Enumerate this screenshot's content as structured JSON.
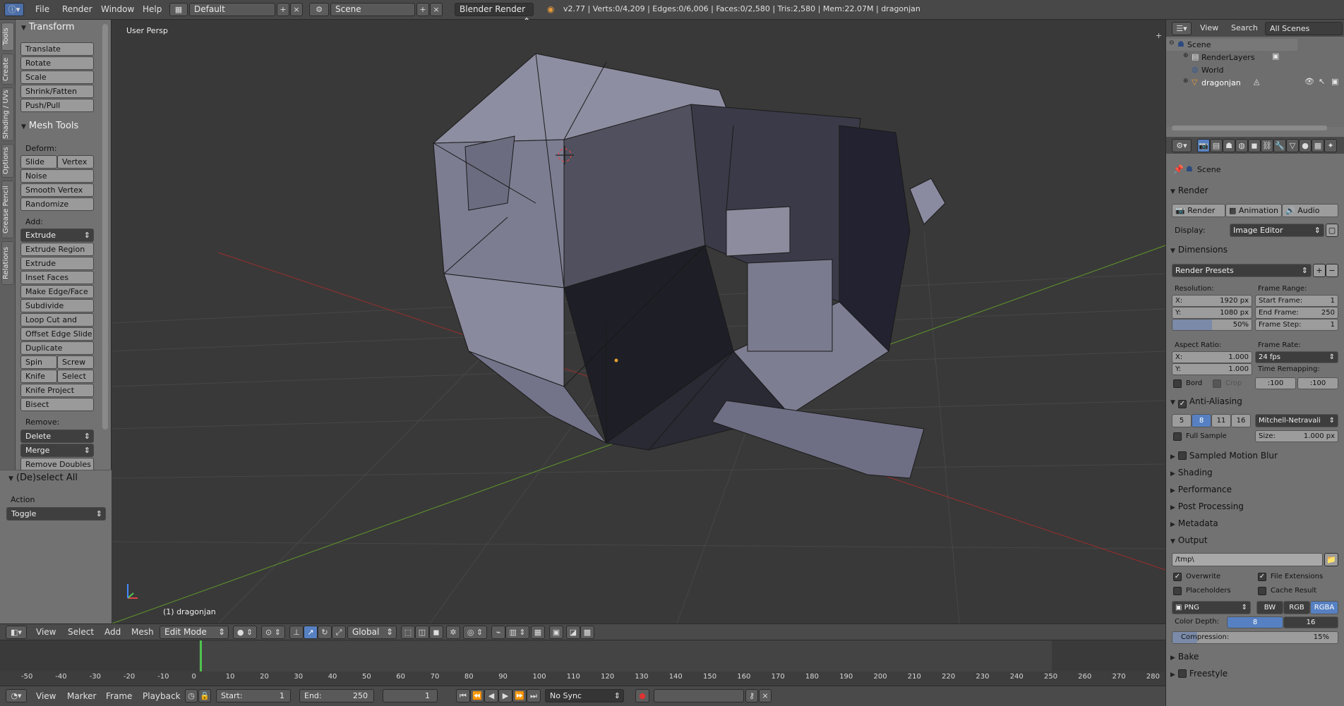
{
  "topbar": {
    "menu": [
      "File",
      "Render",
      "Window",
      "Help"
    ],
    "layout": "Default",
    "scene": "Scene",
    "engine": "Blender Render",
    "info": "v2.77 | Verts:0/4,209 | Edges:0/6,006 | Faces:0/2,580 | Tris:2,580 | Mem:22.07M | dragonjan"
  },
  "toolshelf": {
    "tabs": [
      "Tools",
      "Create",
      "Shading / UVs",
      "Options",
      "Grease Pencil",
      "Relations"
    ],
    "transform_title": "Transform",
    "transform": [
      "Translate",
      "Rotate",
      "Scale",
      "Shrink/Fatten",
      "Push/Pull"
    ],
    "mesh_title": "Mesh Tools",
    "deform_label": "Deform:",
    "slide_edge": "Slide Ed",
    "vertex": "Vertex",
    "deform": [
      "Noise",
      "Smooth Vertex",
      "Randomize"
    ],
    "add_label": "Add:",
    "extrude": "Extrude",
    "add": [
      "Extrude Region",
      "Extrude Individual",
      "Inset Faces",
      "Make Edge/Face",
      "Subdivide",
      "Loop Cut and Slide",
      "Offset Edge Slide",
      "Duplicate"
    ],
    "spin": "Spin",
    "screw": "Screw",
    "knife": "Knife",
    "select": "Select",
    "knife_project": "Knife Project",
    "bisect": "Bisect",
    "remove_label": "Remove:",
    "delete": "Delete",
    "merge": "Merge",
    "remove_doubles": "Remove Doubles",
    "op_title": "(De)select All",
    "action_label": "Action",
    "action_value": "Toggle"
  },
  "viewport": {
    "view_name": "User Persp",
    "object_label": "(1) dragonjan"
  },
  "header3d": {
    "menus": [
      "View",
      "Select",
      "Add",
      "Mesh"
    ],
    "mode": "Edit Mode",
    "orientation": "Global"
  },
  "timeline": {
    "ticks": [
      "-50",
      "-40",
      "-30",
      "-20",
      "-10",
      "0",
      "10",
      "20",
      "30",
      "40",
      "50",
      "60",
      "70",
      "80",
      "90",
      "100",
      "110",
      "120",
      "130",
      "140",
      "150",
      "160",
      "170",
      "180",
      "190",
      "200",
      "210",
      "220",
      "230",
      "240",
      "250",
      "260",
      "270",
      "280"
    ],
    "menus": [
      "View",
      "Marker",
      "Frame",
      "Playback"
    ],
    "start_label": "Start:",
    "start": "1",
    "end_label": "End:",
    "end": "250",
    "current": "1",
    "sync": "No Sync"
  },
  "outliner": {
    "view": "View",
    "search": "Search",
    "scope": "All Scenes",
    "items": [
      "Scene",
      "RenderLayers",
      "World",
      "dragonjan"
    ]
  },
  "properties": {
    "context": "Scene",
    "render_title": "Render",
    "render_btn": "Render",
    "animation_btn": "Animation",
    "audio_btn": "Audio",
    "display_label": "Display:",
    "display_value": "Image Editor",
    "dimensions_title": "Dimensions",
    "presets": "Render Presets",
    "resolution_label": "Resolution:",
    "res_x": "X:",
    "res_x_val": "1920 px",
    "res_y": "Y:",
    "res_y_val": "1080 px",
    "res_pct": "50%",
    "frame_range_label": "Frame Range:",
    "start_frame": "Start Frame:",
    "start_frame_val": "1",
    "end_frame": "End Frame:",
    "end_frame_val": "250",
    "frame_step": "Frame Step:",
    "frame_step_val": "1",
    "aspect_label": "Aspect Ratio:",
    "asp_x": "X:",
    "asp_x_val": "1.000",
    "asp_y": "Y:",
    "asp_y_val": "1.000",
    "frame_rate_label": "Frame Rate:",
    "frame_rate": "24 fps",
    "time_remap_label": "Time Remapping:",
    "remap_old": ":100",
    "remap_new": ":100",
    "bord": "Bord",
    "crop": "Crop",
    "aa_title": "Anti-Aliasing",
    "aa_samples": [
      "5",
      "8",
      "11",
      "16"
    ],
    "aa_filter": "Mitchell-Netravali",
    "full_sample": "Full Sample",
    "size_label": "Size:",
    "size_val": "1.000 px",
    "collapsed": [
      "Sampled Motion Blur",
      "Shading",
      "Performance",
      "Post Processing",
      "Metadata"
    ],
    "output_title": "Output",
    "output_path": "/tmp\\",
    "overwrite": "Overwrite",
    "file_ext": "File Extensions",
    "placeholders": "Placeholders",
    "cache_result": "Cache Result",
    "format": "PNG",
    "bw": "BW",
    "rgb": "RGB",
    "rgba": "RGBA",
    "color_depth_label": "Color Depth:",
    "depth8": "8",
    "depth16": "16",
    "compression": "Compression:",
    "compression_val": "15%",
    "bake": "Bake",
    "freestyle": "Freestyle"
  }
}
